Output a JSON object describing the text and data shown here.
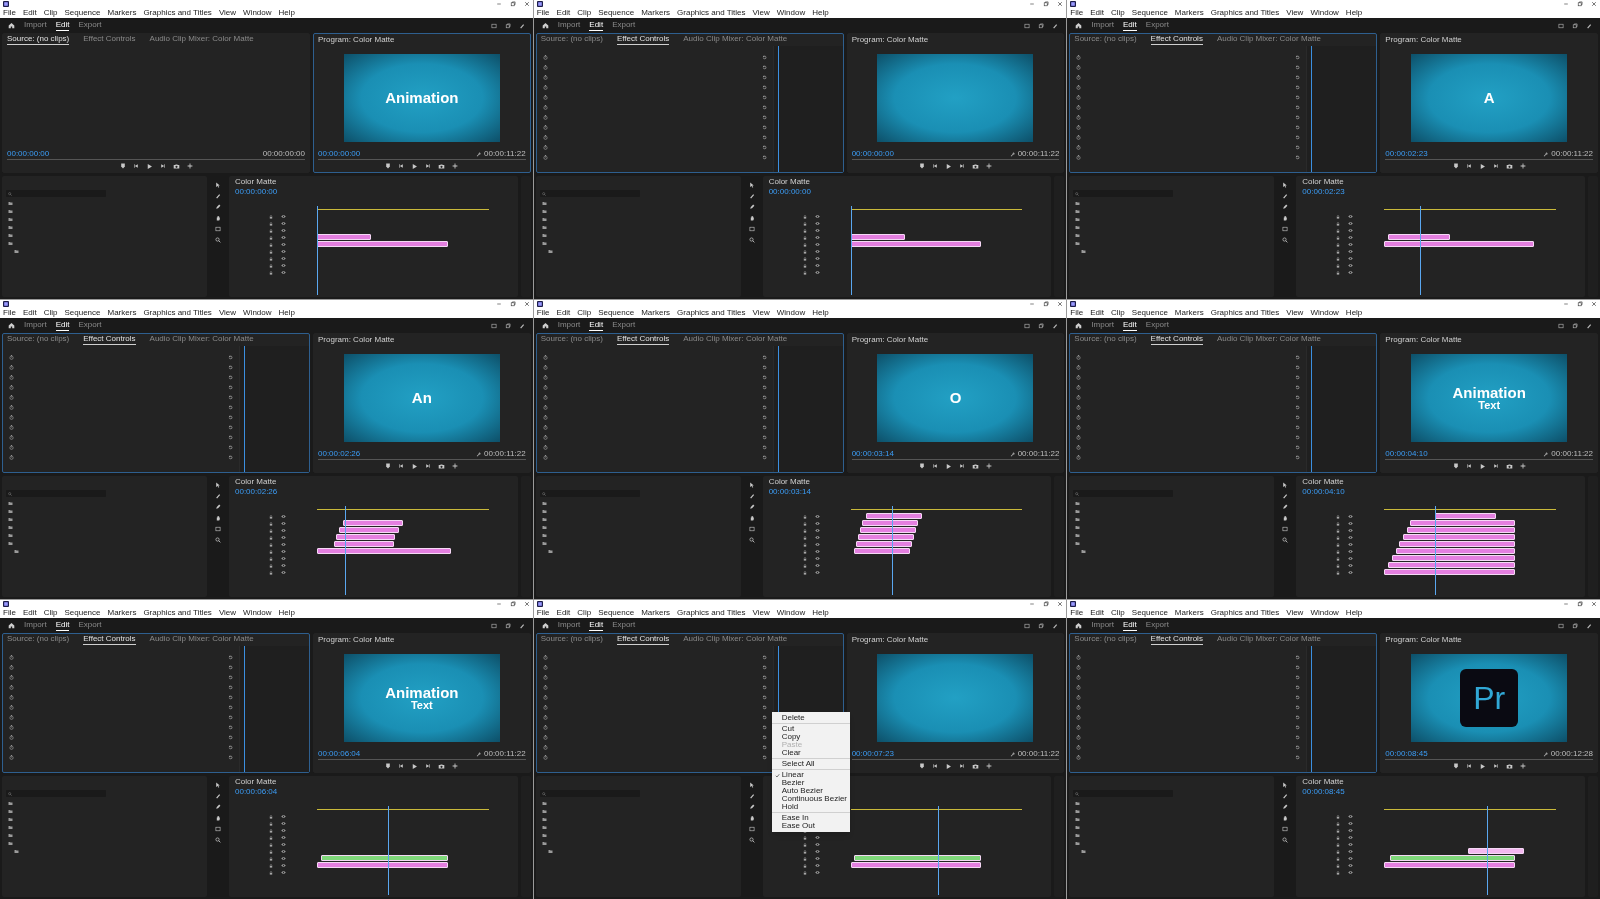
{
  "tiles": [
    {
      "menus": [
        "File",
        "Edit",
        "Clip",
        "Sequence",
        "Markers",
        "Graphics and Titles",
        "View",
        "Window",
        "Help"
      ],
      "workspaces": [
        {
          "label": "Import",
          "selected": false
        },
        {
          "label": "Edit",
          "selected": true
        },
        {
          "label": "Export",
          "selected": false
        }
      ],
      "top_tabs": [
        {
          "label": "Source: (no clips)",
          "selected": true
        },
        {
          "label": "Effect Controls",
          "selected": false
        },
        {
          "label": "Audio Clip Mixer: Color Matte",
          "selected": false
        }
      ],
      "source_times": [
        "00:00:00:00",
        "00:00:00:00"
      ],
      "program_title": "Program: Color Matte",
      "program_time": "00:00:00:00",
      "program_duration": "00:00:11:22",
      "overlay": {
        "kind": "title",
        "lines": [
          "Animation"
        ]
      },
      "sequence_title": "Color Matte",
      "timeline_time": "00:00:00:00",
      "clips": [
        {
          "color": "#e47fe0"
        },
        {
          "color": "#e47fe0"
        }
      ]
    },
    {
      "menus": [
        "File",
        "Edit",
        "Clip",
        "Sequence",
        "Markers",
        "Graphics and Titles",
        "View",
        "Window",
        "Help"
      ],
      "workspaces": [
        {
          "label": "Import",
          "selected": false
        },
        {
          "label": "Edit",
          "selected": true
        },
        {
          "label": "Export",
          "selected": false
        }
      ],
      "top_tabs": [
        {
          "label": "Source: (no clips)",
          "selected": false
        },
        {
          "label": "Effect Controls",
          "selected": true
        },
        {
          "label": "Audio Clip Mixer: Color Matte",
          "selected": false
        }
      ],
      "program_title": "Program: Color Matte",
      "program_time": "00:00:00:00",
      "program_duration": "00:00:11:22",
      "sequence_title": "Color Matte",
      "timeline_time": "00:00:00:00",
      "clips": [
        {
          "color": "#e47fe0"
        },
        {
          "color": "#e47fe0"
        }
      ]
    },
    {
      "menus": [
        "File",
        "Edit",
        "Clip",
        "Sequence",
        "Markers",
        "Graphics and Titles",
        "View",
        "Window",
        "Help"
      ],
      "workspaces": [
        {
          "label": "Import",
          "selected": false
        },
        {
          "label": "Edit",
          "selected": true
        },
        {
          "label": "Export",
          "selected": false
        }
      ],
      "top_tabs": [
        {
          "label": "Source: (no clips)",
          "selected": false
        },
        {
          "label": "Effect Controls",
          "selected": true
        },
        {
          "label": "Audio Clip Mixer: Color Matte",
          "selected": false
        }
      ],
      "program_title": "Program: Color Matte",
      "program_time": "00:00:02:23",
      "program_duration": "00:00:11:22",
      "overlay": {
        "kind": "title",
        "lines": [
          "A"
        ]
      },
      "sequence_title": "Color Matte",
      "timeline_time": "00:00:02:23",
      "clips": [
        {
          "color": "#e47fe0"
        },
        {
          "color": "#e47fe0"
        }
      ]
    },
    {
      "menus": [
        "File",
        "Edit",
        "Clip",
        "Sequence",
        "Markers",
        "Graphics and Titles",
        "View",
        "Window",
        "Help"
      ],
      "workspaces": [
        {
          "label": "Import",
          "selected": false
        },
        {
          "label": "Edit",
          "selected": true
        },
        {
          "label": "Export",
          "selected": false
        }
      ],
      "top_tabs": [
        {
          "label": "Source: (no clips)",
          "selected": false
        },
        {
          "label": "Effect Controls",
          "selected": true
        },
        {
          "label": "Audio Clip Mixer: Color Matte",
          "selected": false
        }
      ],
      "program_title": "Program: Color Matte",
      "program_time": "00:00:02:26",
      "program_duration": "00:00:11:22",
      "overlay": {
        "kind": "title",
        "lines": [
          "An"
        ]
      },
      "sequence_title": "Color Matte",
      "timeline_time": "00:00:02:26",
      "clips": [
        {
          "color": "#e47fe0"
        },
        {
          "color": "#e47fe0"
        },
        {
          "color": "#e47fe0"
        },
        {
          "color": "#e47fe0"
        },
        {
          "color": "#e47fe0"
        }
      ]
    },
    {
      "menus": [
        "File",
        "Edit",
        "Clip",
        "Sequence",
        "Markers",
        "Graphics and Titles",
        "View",
        "Window",
        "Help"
      ],
      "workspaces": [
        {
          "label": "Import",
          "selected": false
        },
        {
          "label": "Edit",
          "selected": true
        },
        {
          "label": "Export",
          "selected": false
        }
      ],
      "top_tabs": [
        {
          "label": "Source: (no clips)",
          "selected": false
        },
        {
          "label": "Effect Controls",
          "selected": true
        },
        {
          "label": "Audio Clip Mixer: Color Matte",
          "selected": false
        }
      ],
      "program_title": "Program: Color Matte",
      "program_time": "00:00:03:14",
      "program_duration": "00:00:11:22",
      "overlay": {
        "kind": "title",
        "lines": [
          "O"
        ]
      },
      "sequence_title": "Color Matte",
      "timeline_time": "00:00:03:14",
      "clips": [
        {
          "color": "#e47fe0"
        },
        {
          "color": "#e47fe0"
        },
        {
          "color": "#e47fe0"
        },
        {
          "color": "#e47fe0"
        },
        {
          "color": "#e47fe0"
        },
        {
          "color": "#e47fe0"
        }
      ]
    },
    {
      "menus": [
        "File",
        "Edit",
        "Clip",
        "Sequence",
        "Markers",
        "Graphics and Titles",
        "View",
        "Window",
        "Help"
      ],
      "workspaces": [
        {
          "label": "Import",
          "selected": false
        },
        {
          "label": "Edit",
          "selected": true
        },
        {
          "label": "Export",
          "selected": false
        }
      ],
      "top_tabs": [
        {
          "label": "Source: (no clips)",
          "selected": false
        },
        {
          "label": "Effect Controls",
          "selected": true
        },
        {
          "label": "Audio Clip Mixer: Color Matte",
          "selected": false
        }
      ],
      "program_title": "Program: Color Matte",
      "program_time": "00:00:04:10",
      "program_duration": "00:00:11:22",
      "overlay": {
        "kind": "title",
        "lines": [
          "Animation",
          "Text"
        ]
      },
      "sequence_title": "Color Matte",
      "timeline_time": "00:00:04:10",
      "clips": [
        {
          "color": "#e47fe0"
        },
        {
          "color": "#e47fe0"
        },
        {
          "color": "#e47fe0"
        },
        {
          "color": "#e47fe0"
        },
        {
          "color": "#e47fe0"
        },
        {
          "color": "#e47fe0"
        },
        {
          "color": "#e47fe0"
        },
        {
          "color": "#e47fe0"
        },
        {
          "color": "#e47fe0"
        }
      ]
    },
    {
      "menus": [
        "File",
        "Edit",
        "Clip",
        "Sequence",
        "Markers",
        "Graphics and Titles",
        "View",
        "Window",
        "Help"
      ],
      "workspaces": [
        {
          "label": "Import",
          "selected": false
        },
        {
          "label": "Edit",
          "selected": true
        },
        {
          "label": "Export",
          "selected": false
        }
      ],
      "top_tabs": [
        {
          "label": "Source: (no clips)",
          "selected": false
        },
        {
          "label": "Effect Controls",
          "selected": true
        },
        {
          "label": "Audio Clip Mixer: Color Matte",
          "selected": false
        }
      ],
      "program_title": "Program: Color Matte",
      "program_time": "00:00:06:04",
      "program_duration": "00:00:11:22",
      "overlay": {
        "kind": "title",
        "lines": [
          "Animation",
          "Text"
        ]
      },
      "sequence_title": "Color Matte",
      "timeline_time": "00:00:06:04",
      "clips": [
        {
          "color": "#7fd77a"
        },
        {
          "color": "#e47fe0"
        }
      ]
    },
    {
      "menus": [
        "File",
        "Edit",
        "Clip",
        "Sequence",
        "Markers",
        "Graphics and Titles",
        "View",
        "Window",
        "Help"
      ],
      "workspaces": [
        {
          "label": "Import",
          "selected": false
        },
        {
          "label": "Edit",
          "selected": true
        },
        {
          "label": "Export",
          "selected": false
        }
      ],
      "top_tabs": [
        {
          "label": "Source: (no clips)",
          "selected": false
        },
        {
          "label": "Effect Controls",
          "selected": true
        },
        {
          "label": "Audio Clip Mixer: Color Matte",
          "selected": false
        }
      ],
      "program_title": "Program: Color Matte",
      "program_time": "00:00:07:23",
      "program_duration": "00:00:11:22",
      "clips": [
        {
          "color": "#7fd77a"
        },
        {
          "color": "#e47fe0"
        }
      ],
      "context_menu": [
        [
          {
            "label": "Delete",
            "checked": false,
            "disabled": false
          }
        ],
        [
          {
            "label": "Cut",
            "checked": false,
            "disabled": false
          },
          {
            "label": "Copy",
            "checked": false,
            "disabled": false
          },
          {
            "label": "Paste",
            "checked": false,
            "disabled": true
          },
          {
            "label": "Clear",
            "checked": false,
            "disabled": false
          }
        ],
        [
          {
            "label": "Select All",
            "checked": false,
            "disabled": false
          }
        ],
        [
          {
            "label": "Linear",
            "checked": true,
            "disabled": false
          },
          {
            "label": "Bezier",
            "checked": false,
            "disabled": false
          },
          {
            "label": "Auto Bezier",
            "checked": false,
            "disabled": false
          },
          {
            "label": "Continuous Bezier",
            "checked": false,
            "disabled": false
          },
          {
            "label": "Hold",
            "checked": false,
            "disabled": false
          }
        ],
        [
          {
            "label": "Ease In",
            "checked": false,
            "disabled": false
          },
          {
            "label": "Ease Out",
            "checked": false,
            "disabled": false
          }
        ]
      ]
    },
    {
      "menus": [
        "File",
        "Edit",
        "Clip",
        "Sequence",
        "Markers",
        "Graphics and Titles",
        "View",
        "Window",
        "Help"
      ],
      "workspaces": [
        {
          "label": "Import",
          "selected": false
        },
        {
          "label": "Edit",
          "selected": true
        },
        {
          "label": "Export",
          "selected": false
        }
      ],
      "top_tabs": [
        {
          "label": "Source: (no clips)",
          "selected": false
        },
        {
          "label": "Effect Controls",
          "selected": true
        },
        {
          "label": "Audio Clip Mixer: Color Matte",
          "selected": false
        }
      ],
      "program_title": "Program: Color Matte",
      "program_time": "00:00:08:45",
      "program_duration": "00:00:12:28",
      "overlay": {
        "kind": "logo",
        "lines": [
          "Pr"
        ]
      },
      "sequence_title": "Color Matte",
      "timeline_time": "00:00:08:45",
      "clips": [
        {
          "color": "#f3b8ef"
        },
        {
          "color": "#7fd77a"
        },
        {
          "color": "#e47fe0"
        }
      ]
    }
  ]
}
